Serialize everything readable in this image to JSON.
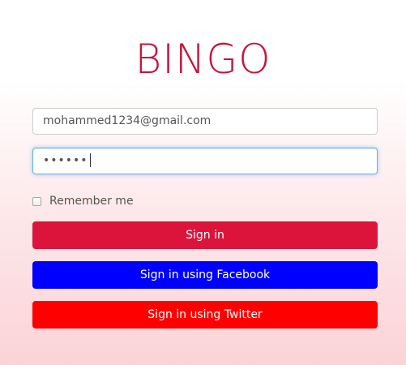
{
  "brand": {
    "title": "BINGO"
  },
  "form": {
    "email_value": "mohammed1234@gmail.com",
    "password_masked": "••••••",
    "remember_label": "Remember me",
    "remember_checked": false
  },
  "buttons": {
    "signin_label": "Sign in",
    "facebook_label": "Sign in using Facebook",
    "twitter_label": "Sign in using Twitter"
  },
  "colors": {
    "brand": "#c8143c",
    "signin": "#dc143c",
    "facebook": "#0000ff",
    "twitter": "#ff0000",
    "focus_border": "#66afe9"
  }
}
